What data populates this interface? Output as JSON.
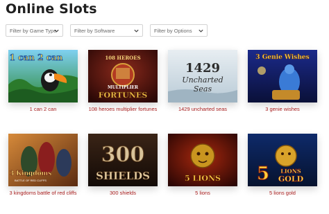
{
  "page": {
    "title": "Online Slots"
  },
  "filters": [
    {
      "label": "Filter by Game Type"
    },
    {
      "label": "Filter by Software"
    },
    {
      "label": "Filter by Options"
    }
  ],
  "games": [
    {
      "title": "1 can 2 can",
      "logo": "1 can 2 can"
    },
    {
      "title": "108 heroes multiplier fortunes",
      "logo_top": "108 HEROES",
      "logo_mid": "MULTIPLIER",
      "logo_bottom": "FORTUNES"
    },
    {
      "title": "1429 uncharted seas",
      "logo_top": "1429",
      "logo_mid": "Uncharted",
      "logo_bottom": "Seas"
    },
    {
      "title": "3 genie wishes",
      "logo": "3 Genie Wishes"
    },
    {
      "title": "3 kingdoms battle of red cliffs",
      "logo": "3 Kingdoms",
      "logo_sub": "BATTLE OF RED CLIFFS"
    },
    {
      "title": "300 shields",
      "logo_top": "300",
      "logo_bottom": "SHIELDS"
    },
    {
      "title": "5 lions",
      "logo": "5 LIONS"
    },
    {
      "title": "5 lions gold",
      "logo_num": "5",
      "logo_top": "LIONS",
      "logo_bottom": "GOLD"
    }
  ],
  "colors": {
    "caption": "#a81c1c",
    "title": "#1f1f1f",
    "filter_border": "#d3d3d3"
  },
  "icons": {
    "filter_arrow": "chevron-down-icon"
  }
}
